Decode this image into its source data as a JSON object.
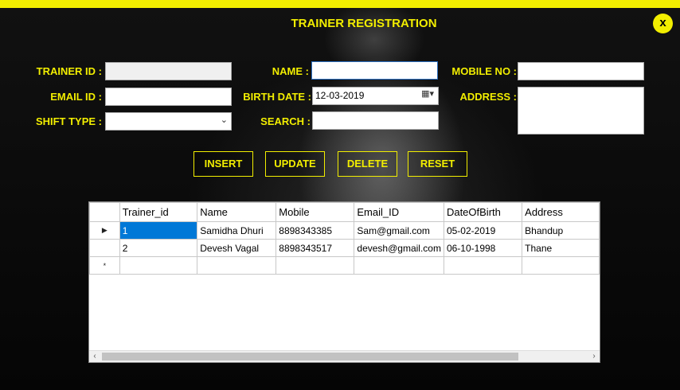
{
  "window": {
    "title": "TRAINER REGISTRATION",
    "close_label": "x"
  },
  "form": {
    "trainer_id": {
      "label": "TRAINER ID :",
      "value": ""
    },
    "email_id": {
      "label": "EMAIL ID :",
      "value": ""
    },
    "shift_type": {
      "label": "SHIFT TYPE :",
      "value": ""
    },
    "name": {
      "label": "NAME :",
      "value": ""
    },
    "birth_date": {
      "label": "BIRTH DATE :",
      "value": "12-03-2019"
    },
    "search": {
      "label": "SEARCH :",
      "value": ""
    },
    "mobile_no": {
      "label": "MOBILE NO :",
      "value": ""
    },
    "address": {
      "label": "ADDRESS :",
      "value": ""
    }
  },
  "buttons": {
    "insert": "INSERT",
    "update": "UPDATE",
    "delete": "DELETE",
    "reset": "RESET"
  },
  "grid": {
    "columns": [
      "Trainer_id",
      "Name",
      "Mobile",
      "Email_ID",
      "DateOfBirth",
      "Address"
    ],
    "rows": [
      [
        "1",
        "Samidha Dhuri",
        "8898343385",
        "Sam@gmail.com",
        "05-02-2019",
        "Bhandup"
      ],
      [
        "2",
        "Devesh Vagal",
        "8898343517",
        "devesh@gmail.com",
        "06-10-1998",
        "Thane"
      ]
    ],
    "current_row_marker": "▶",
    "new_row_marker": "*"
  }
}
